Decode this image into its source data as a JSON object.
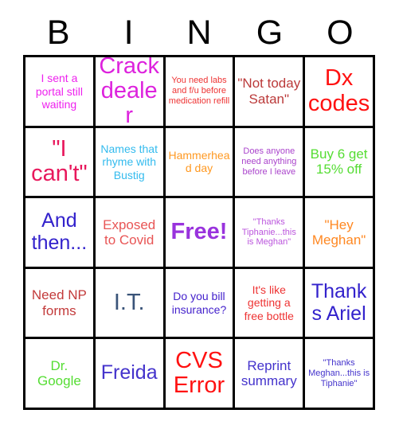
{
  "card": {
    "header_letters": [
      "B",
      "I",
      "N",
      "G",
      "O"
    ],
    "columns": 5,
    "rows": 5,
    "border_color": "#000000",
    "background_color": "#ffffff",
    "header_text_color": "#000000"
  },
  "cells": [
    {
      "row": 1,
      "col": 1,
      "column_letter": "B",
      "text": "I sent a portal still waiting",
      "color": "#EE22EE",
      "size": "sm",
      "bold": false
    },
    {
      "row": 1,
      "col": 2,
      "column_letter": "I",
      "text": "Crack dealer",
      "color": "#DD22DD",
      "size": "xl",
      "bold": false
    },
    {
      "row": 1,
      "col": 3,
      "column_letter": "N",
      "text": "You need labs and f/u before medication refill",
      "color": "#EE3333",
      "size": "xs",
      "bold": false
    },
    {
      "row": 1,
      "col": 4,
      "column_letter": "G",
      "text": "\"Not today Satan\"",
      "color": "#BB3A3A",
      "size": "md",
      "bold": false
    },
    {
      "row": 1,
      "col": 5,
      "column_letter": "O",
      "text": "Dx codes",
      "color": "#FF1111",
      "size": "xl",
      "bold": false
    },
    {
      "row": 2,
      "col": 1,
      "column_letter": "B",
      "text": "\"I can't\"",
      "color": "#E8185C",
      "size": "xl",
      "bold": false
    },
    {
      "row": 2,
      "col": 2,
      "column_letter": "I",
      "text": "Names that rhyme with Bustig",
      "color": "#33BBEE",
      "size": "sm",
      "bold": false
    },
    {
      "row": 2,
      "col": 3,
      "column_letter": "N",
      "text": "Hammerhead day",
      "color": "#FF9922",
      "size": "sm",
      "bold": false
    },
    {
      "row": 2,
      "col": 4,
      "column_letter": "G",
      "text": "Does anyone need anything before I leave",
      "color": "#AA44CC",
      "size": "xs",
      "bold": false
    },
    {
      "row": 2,
      "col": 5,
      "column_letter": "O",
      "text": "Buy 6 get 15% off",
      "color": "#55DD33",
      "size": "md",
      "bold": false
    },
    {
      "row": 3,
      "col": 1,
      "column_letter": "B",
      "text": "And then...",
      "color": "#3322CC",
      "size": "lg",
      "bold": false
    },
    {
      "row": 3,
      "col": 2,
      "column_letter": "I",
      "text": "Exposed to Covid",
      "color": "#E85555",
      "size": "md",
      "bold": false
    },
    {
      "row": 3,
      "col": 3,
      "column_letter": "N",
      "text": "Free!",
      "color": "#9933DD",
      "size": "xl",
      "bold": true
    },
    {
      "row": 3,
      "col": 4,
      "column_letter": "G",
      "text": "\"Thanks Tiphanie...this is Meghan\"",
      "color": "#BB55DD",
      "size": "xs",
      "bold": false
    },
    {
      "row": 3,
      "col": 5,
      "column_letter": "O",
      "text": "\"Hey Meghan\"",
      "color": "#FF8822",
      "size": "md",
      "bold": false
    },
    {
      "row": 4,
      "col": 1,
      "column_letter": "B",
      "text": "Need NP forms",
      "color": "#C33B3B",
      "size": "md",
      "bold": false
    },
    {
      "row": 4,
      "col": 2,
      "column_letter": "I",
      "text": "I.T.",
      "color": "#3A5479",
      "size": "xl",
      "bold": false
    },
    {
      "row": 4,
      "col": 3,
      "column_letter": "N",
      "text": "Do you bill insurance?",
      "color": "#4422CC",
      "size": "sm",
      "bold": false
    },
    {
      "row": 4,
      "col": 4,
      "column_letter": "G",
      "text": "It's like getting a free bottle",
      "color": "#EE3333",
      "size": "sm",
      "bold": false
    },
    {
      "row": 4,
      "col": 5,
      "column_letter": "O",
      "text": "Thanks Ariel",
      "color": "#3322CC",
      "size": "lg",
      "bold": false
    },
    {
      "row": 5,
      "col": 1,
      "column_letter": "B",
      "text": "Dr. Google",
      "color": "#55DD33",
      "size": "md",
      "bold": false
    },
    {
      "row": 5,
      "col": 2,
      "column_letter": "I",
      "text": "Freida",
      "color": "#4433CC",
      "size": "lg",
      "bold": false
    },
    {
      "row": 5,
      "col": 3,
      "column_letter": "N",
      "text": "CVS Error",
      "color": "#FF1111",
      "size": "xl",
      "bold": false
    },
    {
      "row": 5,
      "col": 4,
      "column_letter": "G",
      "text": "Reprint summary",
      "color": "#4433CC",
      "size": "md",
      "bold": false
    },
    {
      "row": 5,
      "col": 5,
      "column_letter": "O",
      "text": "\"Thanks Meghan...this is Tiphanie\"",
      "color": "#4433CC",
      "size": "xs",
      "bold": false
    }
  ]
}
